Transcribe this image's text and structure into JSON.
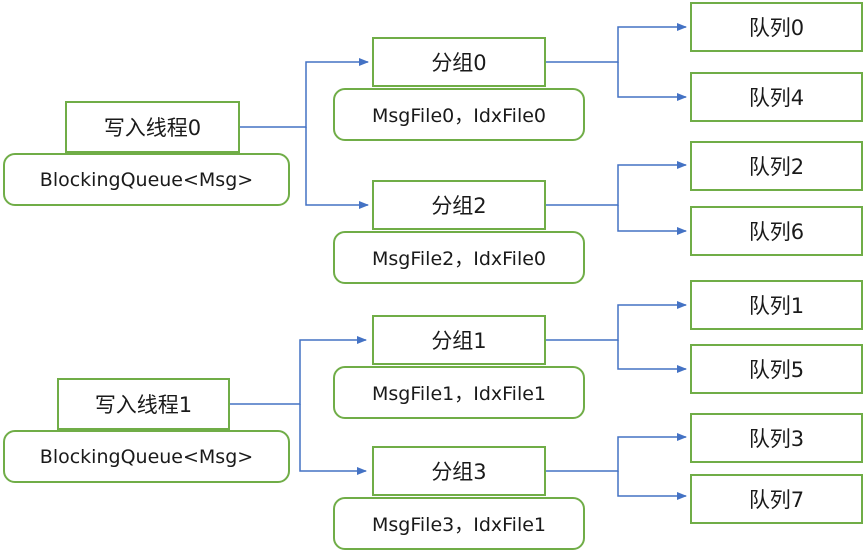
{
  "threads": [
    {
      "title": "写入线程0",
      "queue": "BlockingQueue<Msg>"
    },
    {
      "title": "写入线程1",
      "queue": "BlockingQueue<Msg>"
    }
  ],
  "groups": [
    {
      "title": "分组0",
      "files": "MsgFile0，IdxFile0",
      "queues": [
        "队列0",
        "队列4"
      ]
    },
    {
      "title": "分组2",
      "files": "MsgFile2，IdxFile0",
      "queues": [
        "队列2",
        "队列6"
      ]
    },
    {
      "title": "分组1",
      "files": "MsgFile1，IdxFile1",
      "queues": [
        "队列1",
        "队列5"
      ]
    },
    {
      "title": "分组3",
      "files": "MsgFile3，IdxFile1",
      "queues": [
        "队列3",
        "队列7"
      ]
    }
  ],
  "colors": {
    "border": "#70ad47",
    "arrow": "#4472c4"
  }
}
